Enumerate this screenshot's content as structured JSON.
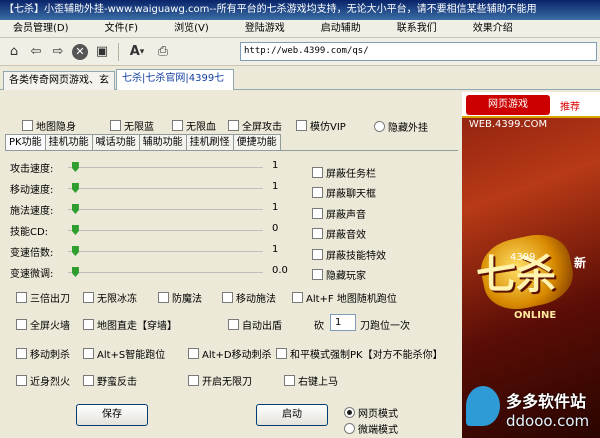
{
  "window": {
    "title": "【七杀】小歪辅助外挂-www.waiguawg.com--所有平台的七杀游戏均支持，无论大小平台，请不要相信某些辅助不能用"
  },
  "menu": [
    "会员管理(D)",
    "文件(F)",
    "浏览(V)",
    "登陆游戏",
    "启动辅助",
    "联系我们",
    "效果介绍"
  ],
  "toolbar": {
    "icons": [
      "home-icon",
      "back-icon",
      "forward-icon",
      "stop-icon",
      "refresh-icon",
      "font-icon",
      "print-icon"
    ],
    "glyphs": {
      "home": "⌂",
      "back": "⇦",
      "forward": "⇨",
      "stop": "✕",
      "refresh": "▣",
      "font": "A",
      "font_arrow": "▾",
      "print": "⎙"
    },
    "address": "http://web.4399.com/qs/"
  },
  "browser_tabs": [
    "各类传奇网页游戏、玄",
    "七杀|七杀官网|4399七"
  ],
  "top_options": {
    "items": [
      "地图隐身",
      "无限蓝",
      "无限血",
      "全屏攻击",
      "模仿VIP"
    ],
    "hide_label": "隐藏外挂"
  },
  "feature_tabs": [
    "PK功能",
    "挂机功能",
    "喊话功能",
    "辅助功能",
    "挂机刷怪",
    "便捷功能"
  ],
  "sliders": [
    {
      "label": "攻击速度:",
      "value": "1",
      "level": 0.02
    },
    {
      "label": "移动速度:",
      "value": "1",
      "level": 0.02
    },
    {
      "label": "施法速度:",
      "value": "1",
      "level": 0.02
    },
    {
      "label": "技能CD:",
      "value": "0",
      "level": 0.02
    },
    {
      "label": "变速倍数:",
      "value": "1",
      "level": 0.02
    },
    {
      "label": "变速微调:",
      "value": "0.0",
      "level": 0.02
    }
  ],
  "shield_options": [
    "屏蔽任务栏",
    "屏蔽聊天框",
    "屏蔽声音",
    "屏蔽音效",
    "屏蔽技能特效",
    "隐藏玩家"
  ],
  "row1": [
    "三倍出刀",
    "无限冰冻",
    "防魔法",
    "移动施法",
    "Alt+F 地图随机跑位"
  ],
  "row2": [
    "全屏火墙",
    "地图直走【穿墙】",
    "自动出盾"
  ],
  "row2_extra": {
    "prefix": "砍",
    "value": "1",
    "suffix": "刀跑位一次"
  },
  "row3": [
    "移动刺杀",
    "Alt+S智能跑位",
    "Alt+D移动刺杀",
    "和平模式强制PK【对方不能杀你】"
  ],
  "row4": [
    "近身烈火",
    "野蛮反击",
    "开启无限刀",
    "右键上马"
  ],
  "buttons": {
    "save": "保存",
    "start": "启动"
  },
  "mode": {
    "web": "网页模式",
    "client": "微端模式"
  },
  "ad": {
    "logo": "网页游戏 WEB.4399.COM",
    "recommend": "推荐",
    "game_num": "4399",
    "game_title": "七杀",
    "game_new": "新",
    "game_online": "ONLINE"
  },
  "watermark": {
    "name": "多多软件站",
    "url": "ddooo.com"
  }
}
